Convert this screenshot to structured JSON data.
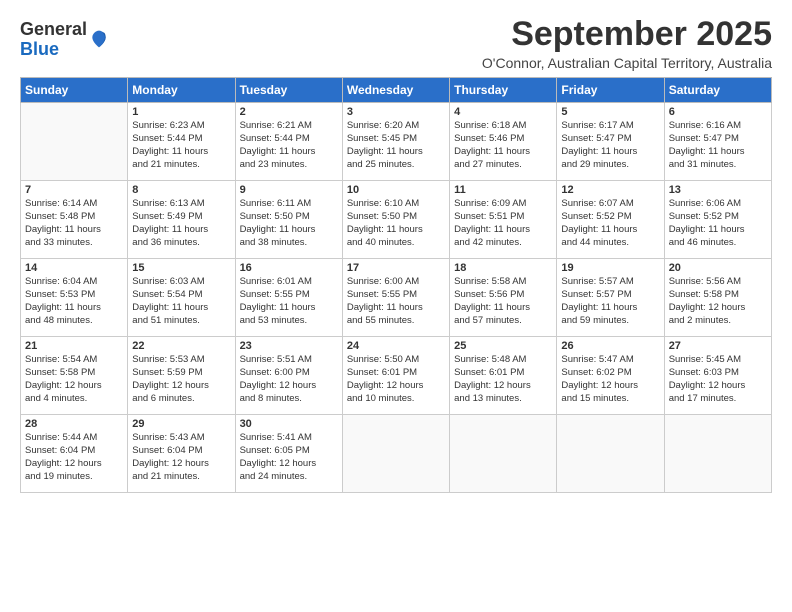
{
  "logo": {
    "general": "General",
    "blue": "Blue"
  },
  "title": "September 2025",
  "subtitle": "O'Connor, Australian Capital Territory, Australia",
  "days_of_week": [
    "Sunday",
    "Monday",
    "Tuesday",
    "Wednesday",
    "Thursday",
    "Friday",
    "Saturday"
  ],
  "weeks": [
    [
      {
        "day": "",
        "info": ""
      },
      {
        "day": "1",
        "info": "Sunrise: 6:23 AM\nSunset: 5:44 PM\nDaylight: 11 hours\nand 21 minutes."
      },
      {
        "day": "2",
        "info": "Sunrise: 6:21 AM\nSunset: 5:44 PM\nDaylight: 11 hours\nand 23 minutes."
      },
      {
        "day": "3",
        "info": "Sunrise: 6:20 AM\nSunset: 5:45 PM\nDaylight: 11 hours\nand 25 minutes."
      },
      {
        "day": "4",
        "info": "Sunrise: 6:18 AM\nSunset: 5:46 PM\nDaylight: 11 hours\nand 27 minutes."
      },
      {
        "day": "5",
        "info": "Sunrise: 6:17 AM\nSunset: 5:47 PM\nDaylight: 11 hours\nand 29 minutes."
      },
      {
        "day": "6",
        "info": "Sunrise: 6:16 AM\nSunset: 5:47 PM\nDaylight: 11 hours\nand 31 minutes."
      }
    ],
    [
      {
        "day": "7",
        "info": "Sunrise: 6:14 AM\nSunset: 5:48 PM\nDaylight: 11 hours\nand 33 minutes."
      },
      {
        "day": "8",
        "info": "Sunrise: 6:13 AM\nSunset: 5:49 PM\nDaylight: 11 hours\nand 36 minutes."
      },
      {
        "day": "9",
        "info": "Sunrise: 6:11 AM\nSunset: 5:50 PM\nDaylight: 11 hours\nand 38 minutes."
      },
      {
        "day": "10",
        "info": "Sunrise: 6:10 AM\nSunset: 5:50 PM\nDaylight: 11 hours\nand 40 minutes."
      },
      {
        "day": "11",
        "info": "Sunrise: 6:09 AM\nSunset: 5:51 PM\nDaylight: 11 hours\nand 42 minutes."
      },
      {
        "day": "12",
        "info": "Sunrise: 6:07 AM\nSunset: 5:52 PM\nDaylight: 11 hours\nand 44 minutes."
      },
      {
        "day": "13",
        "info": "Sunrise: 6:06 AM\nSunset: 5:52 PM\nDaylight: 11 hours\nand 46 minutes."
      }
    ],
    [
      {
        "day": "14",
        "info": "Sunrise: 6:04 AM\nSunset: 5:53 PM\nDaylight: 11 hours\nand 48 minutes."
      },
      {
        "day": "15",
        "info": "Sunrise: 6:03 AM\nSunset: 5:54 PM\nDaylight: 11 hours\nand 51 minutes."
      },
      {
        "day": "16",
        "info": "Sunrise: 6:01 AM\nSunset: 5:55 PM\nDaylight: 11 hours\nand 53 minutes."
      },
      {
        "day": "17",
        "info": "Sunrise: 6:00 AM\nSunset: 5:55 PM\nDaylight: 11 hours\nand 55 minutes."
      },
      {
        "day": "18",
        "info": "Sunrise: 5:58 AM\nSunset: 5:56 PM\nDaylight: 11 hours\nand 57 minutes."
      },
      {
        "day": "19",
        "info": "Sunrise: 5:57 AM\nSunset: 5:57 PM\nDaylight: 11 hours\nand 59 minutes."
      },
      {
        "day": "20",
        "info": "Sunrise: 5:56 AM\nSunset: 5:58 PM\nDaylight: 12 hours\nand 2 minutes."
      }
    ],
    [
      {
        "day": "21",
        "info": "Sunrise: 5:54 AM\nSunset: 5:58 PM\nDaylight: 12 hours\nand 4 minutes."
      },
      {
        "day": "22",
        "info": "Sunrise: 5:53 AM\nSunset: 5:59 PM\nDaylight: 12 hours\nand 6 minutes."
      },
      {
        "day": "23",
        "info": "Sunrise: 5:51 AM\nSunset: 6:00 PM\nDaylight: 12 hours\nand 8 minutes."
      },
      {
        "day": "24",
        "info": "Sunrise: 5:50 AM\nSunset: 6:01 PM\nDaylight: 12 hours\nand 10 minutes."
      },
      {
        "day": "25",
        "info": "Sunrise: 5:48 AM\nSunset: 6:01 PM\nDaylight: 12 hours\nand 13 minutes."
      },
      {
        "day": "26",
        "info": "Sunrise: 5:47 AM\nSunset: 6:02 PM\nDaylight: 12 hours\nand 15 minutes."
      },
      {
        "day": "27",
        "info": "Sunrise: 5:45 AM\nSunset: 6:03 PM\nDaylight: 12 hours\nand 17 minutes."
      }
    ],
    [
      {
        "day": "28",
        "info": "Sunrise: 5:44 AM\nSunset: 6:04 PM\nDaylight: 12 hours\nand 19 minutes."
      },
      {
        "day": "29",
        "info": "Sunrise: 5:43 AM\nSunset: 6:04 PM\nDaylight: 12 hours\nand 21 minutes."
      },
      {
        "day": "30",
        "info": "Sunrise: 5:41 AM\nSunset: 6:05 PM\nDaylight: 12 hours\nand 24 minutes."
      },
      {
        "day": "",
        "info": ""
      },
      {
        "day": "",
        "info": ""
      },
      {
        "day": "",
        "info": ""
      },
      {
        "day": "",
        "info": ""
      }
    ]
  ]
}
